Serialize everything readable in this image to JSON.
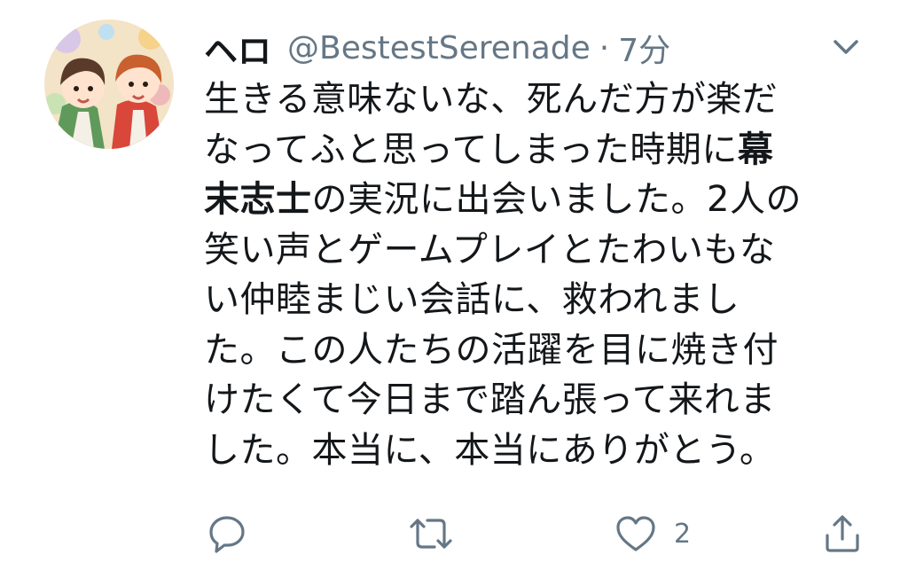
{
  "tweet": {
    "display_name": "ヘロ",
    "handle": "@BestestSerenade",
    "separator": "·",
    "time": "7分",
    "lines": [
      {
        "pre": "生きる意味ないな、死んだ方が楽だ",
        "bold": "",
        "post": ""
      },
      {
        "pre": "なってふと思ってしまった時期に",
        "bold": "幕",
        "post": ""
      },
      {
        "pre": "",
        "bold": "末志士",
        "post": "の実況に出会いました。2人の"
      },
      {
        "pre": "笑い声とゲームプレイとたわいもな",
        "bold": "",
        "post": ""
      },
      {
        "pre": "い仲睦まじい会話に、救われまし",
        "bold": "",
        "post": ""
      },
      {
        "pre": "た。この人たちの活躍を目に焼き付",
        "bold": "",
        "post": ""
      },
      {
        "pre": "けたくて今日まで踏ん張って来れま",
        "bold": "",
        "post": ""
      },
      {
        "pre": "した。本当に、本当にありがとう。",
        "bold": "",
        "post": ""
      }
    ]
  },
  "actions": {
    "reply_icon": "reply-icon",
    "retweet_icon": "retweet-icon",
    "like_icon": "heart-icon",
    "like_count": "2",
    "share_icon": "share-icon"
  },
  "colors": {
    "text": "#14171a",
    "secondary": "#657786"
  }
}
